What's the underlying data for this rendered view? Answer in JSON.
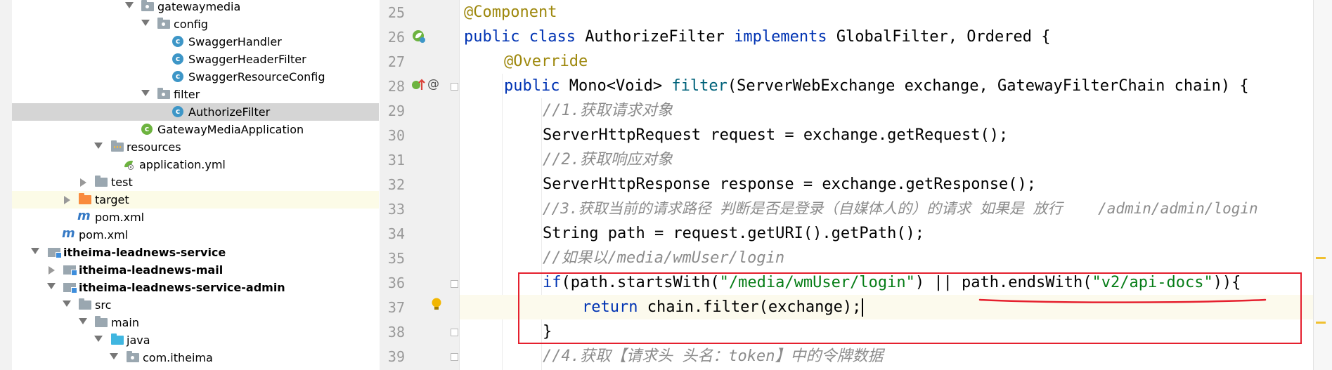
{
  "tree": {
    "items": [
      {
        "label": "gatewaymedia",
        "kind": "package",
        "arrow": "down"
      },
      {
        "label": "config",
        "kind": "package",
        "arrow": "down"
      },
      {
        "label": "SwaggerHandler",
        "kind": "class"
      },
      {
        "label": "SwaggerHeaderFilter",
        "kind": "class"
      },
      {
        "label": "SwaggerResourceConfig",
        "kind": "class"
      },
      {
        "label": "filter",
        "kind": "package",
        "arrow": "down"
      },
      {
        "label": "AuthorizeFilter",
        "kind": "class",
        "selected": true
      },
      {
        "label": "GatewayMediaApplication",
        "kind": "spring-class"
      },
      {
        "label": "resources",
        "kind": "resources",
        "arrow": "down"
      },
      {
        "label": "application.yml",
        "kind": "yml"
      },
      {
        "label": "test",
        "kind": "folder",
        "arrow": "right"
      },
      {
        "label": "target",
        "kind": "excluded",
        "arrow": "right"
      },
      {
        "label": "pom.xml",
        "kind": "maven"
      },
      {
        "label": "pom.xml",
        "kind": "maven"
      },
      {
        "label": "itheima-leadnews-service",
        "kind": "module",
        "arrow": "down"
      },
      {
        "label": "itheima-leadnews-mail",
        "kind": "module",
        "arrow": "right"
      },
      {
        "label": "itheima-leadnews-service-admin",
        "kind": "module",
        "arrow": "down"
      },
      {
        "label": "src",
        "kind": "folder",
        "arrow": "down"
      },
      {
        "label": "main",
        "kind": "folder",
        "arrow": "down"
      },
      {
        "label": "java",
        "kind": "source",
        "arrow": "down"
      },
      {
        "label": "com.itheima",
        "kind": "package",
        "arrow": "down"
      }
    ]
  },
  "editor": {
    "line_numbers": [
      "25",
      "26",
      "27",
      "28",
      "29",
      "30",
      "31",
      "32",
      "33",
      "34",
      "35",
      "36",
      "37",
      "38",
      "39"
    ],
    "code": {
      "l25_ann": "@Component",
      "l26_kw1": "public class ",
      "l26_name": "AuthorizeFilter ",
      "l26_kw2": "implements ",
      "l26_rest": "GlobalFilter, Ordered {",
      "l27_ann": "@Override",
      "l28_kw": "public ",
      "l28_type": "Mono<Void> ",
      "l28_fn": "filter",
      "l28_rest": "(ServerWebExchange exchange, GatewayFilterChain chain) {",
      "l29_cmt": "//1.获取请求对象",
      "l30": "ServerHttpRequest request = exchange.getRequest();",
      "l31_cmt": "//2.获取响应对象",
      "l32": "ServerHttpResponse response = exchange.getResponse();",
      "l33_cmt": "//3.获取当前的请求路径 判断是否是登录（自媒体人的）的请求 如果是 放行    /admin/admin/login",
      "l34": "String path = request.getURI().getPath();",
      "l35_cmt": "//如果以/media/wmUser/login",
      "l36_kw": "if",
      "l36_a": "(path.startsWith(",
      "l36_s1": "\"/media/wmUser/login\"",
      "l36_b": ") || path.endsWith(",
      "l36_s2": "\"v2/api-docs\"",
      "l36_c": ")){",
      "l37_kw": "return ",
      "l37_rest": "chain.filter(exchange);",
      "l38": "}",
      "l39_cmt": "//4.获取【请求头 头名：token】中的令牌数据"
    }
  },
  "colors": {
    "keyword": "#0033b3",
    "annotation": "#9e880d",
    "string": "#067d17",
    "comment": "#8c8c8c",
    "highlight_box": "#e5202e"
  }
}
